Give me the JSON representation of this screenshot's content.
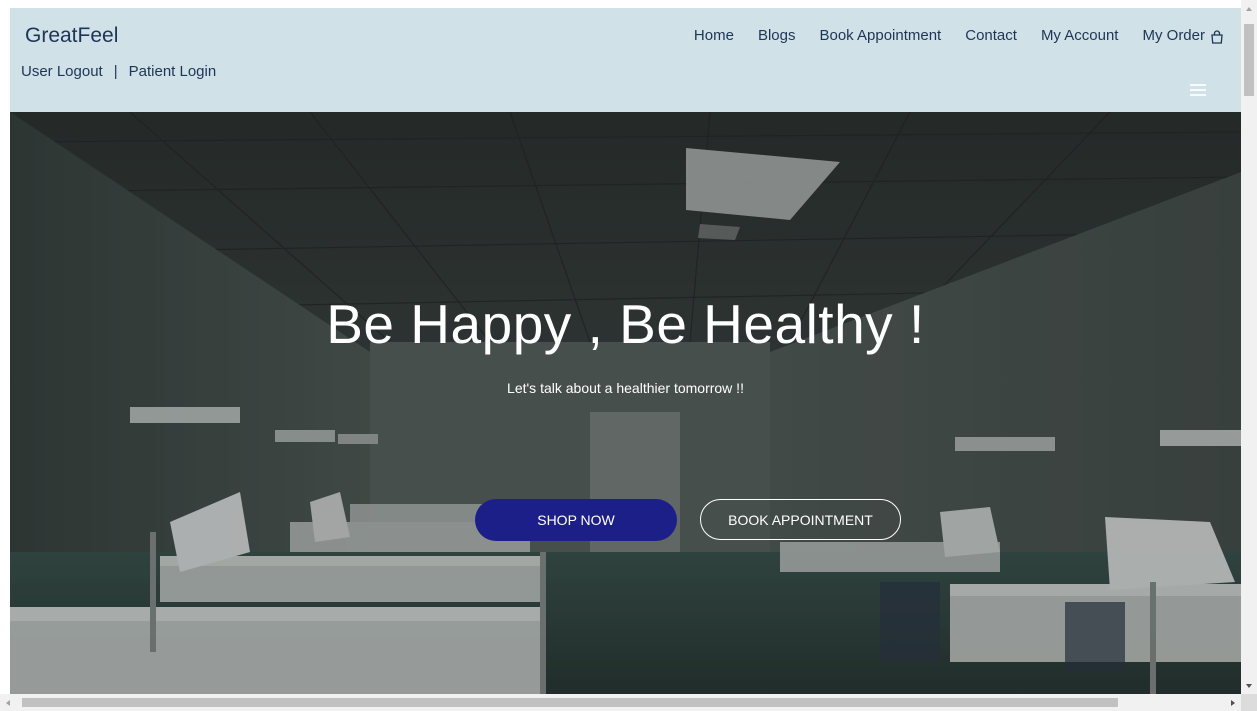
{
  "header": {
    "brand": "GreatFeel",
    "auth": {
      "logout": "User Logout",
      "separator": "|",
      "patient_login": "Patient Login"
    },
    "nav": [
      {
        "label": "Home"
      },
      {
        "label": "Blogs"
      },
      {
        "label": "Book Appointment"
      },
      {
        "label": "Contact"
      },
      {
        "label": "My Account"
      },
      {
        "label": "My Order"
      }
    ],
    "icons": [
      "shopping-bag-icon",
      "hamburger-menu-icon"
    ]
  },
  "hero": {
    "title": "Be Happy , Be Healthy !",
    "subtitle": "Let's talk about a healthier tomorrow !!",
    "shop_button": "SHOP NOW",
    "book_button": "BOOK APPOINTMENT",
    "background": "hospital-ward-photo"
  },
  "colors": {
    "navbar_bg": "#d0e1e8",
    "nav_text": "#1f3556",
    "shop_button": "#1d1f88"
  }
}
